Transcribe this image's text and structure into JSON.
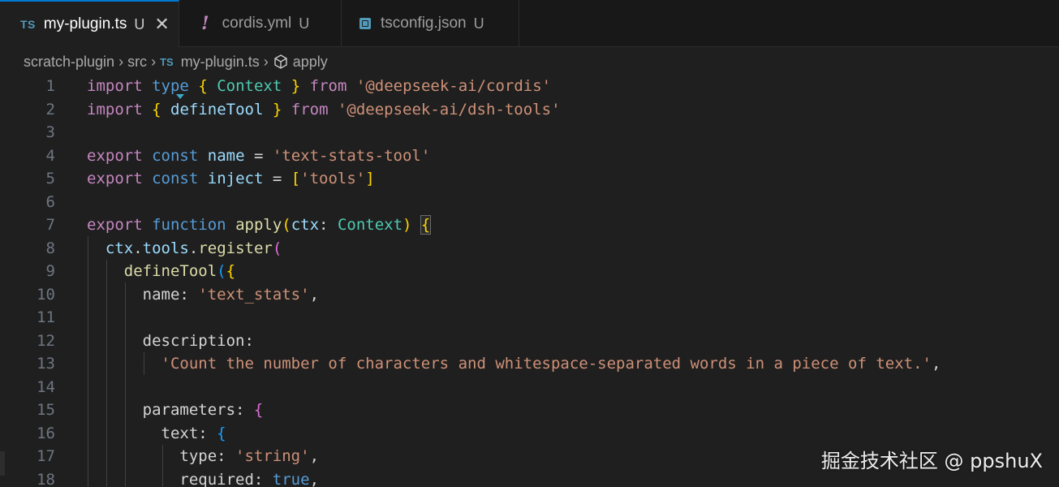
{
  "tabs": [
    {
      "icon": "TS",
      "label": "my-plugin.ts",
      "status": "U",
      "close": "✕"
    },
    {
      "icon": "!",
      "label": "cordis.yml",
      "status": "U"
    },
    {
      "icon": "json",
      "label": "tsconfig.json",
      "status": "U"
    }
  ],
  "breadcrumb": {
    "items": [
      "scratch-plugin",
      "src",
      "my-plugin.ts",
      "apply"
    ],
    "file_icon": "TS",
    "separator": "›"
  },
  "editor": {
    "line_numbers": [
      "1",
      "2",
      "3",
      "4",
      "5",
      "6",
      "7",
      "8",
      "9",
      "10",
      "11",
      "12",
      "13",
      "14",
      "15",
      "16",
      "17",
      "18"
    ]
  },
  "watermark": "掘金技术社区 @ ppshuX",
  "colors": {
    "keyword": "#c586c0",
    "keyword_blue": "#569cd6",
    "function": "#dcdcaa",
    "type": "#4ec9b0",
    "string": "#ce9178",
    "variable": "#9cdcfe",
    "accent": "#0078d4"
  }
}
